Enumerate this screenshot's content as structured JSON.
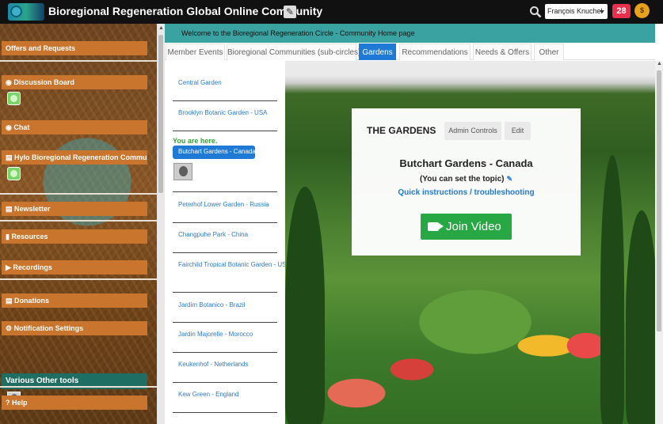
{
  "header": {
    "title": "Bioregional Regeneration Global Online Community",
    "edit_icon": "✎",
    "user_name": "François Knuchel",
    "notification_count": "28",
    "coin_label": "$"
  },
  "sidebar": {
    "items": [
      {
        "label": "Offers and Requests",
        "icon": ""
      },
      {
        "label": "Discussion Board",
        "icon": "comments-icon"
      },
      {
        "label": "Chat",
        "icon": "comment-icon"
      },
      {
        "label": "Hylo Bioregional Regeneration Community",
        "icon": "id-card-icon"
      },
      {
        "label": "Newsletter",
        "icon": "newspaper-icon"
      },
      {
        "label": "Resources",
        "icon": "book-icon"
      },
      {
        "label": "Recordings",
        "icon": "play-icon"
      },
      {
        "label": "Donations",
        "icon": "credit-card-icon"
      },
      {
        "label": "Notification Settings",
        "icon": "gear-icon"
      }
    ],
    "tools_label": "Various Other tools",
    "help_label": "? Help"
  },
  "welcome": "Welcome to the Bioregional Regeneration Circle - Community Home page",
  "tabs": [
    {
      "label": "Member Events"
    },
    {
      "label": "Bioregional Communities (sub-circles)"
    },
    {
      "label": "Gardens",
      "active": true
    },
    {
      "label": "Recommendations"
    },
    {
      "label": "Needs & Offers"
    },
    {
      "label": "Other"
    }
  ],
  "rooms": {
    "you_are_here": "You are here.",
    "current": "Butchart Gardens - Canada",
    "list": [
      "Central Garden",
      "Brooklyn Botanic Garden - USA",
      "Peterhof Lower Garden - Russia",
      "Changpuhe Park - China",
      "Fairchild Tropical Botanic Garden - USA",
      "Jardim Botanico - Brazil",
      "Jardin Majorelle - Morocco",
      "Keukenhof - Netherlands",
      "Kew Green - England"
    ]
  },
  "card": {
    "title": "THE GARDENS",
    "admin_label": "Admin Controls",
    "edit_label": "Edit",
    "room_name": "Butchart Gardens - Canada",
    "topic_hint": "(You can set the topic)",
    "instructions_link": "Quick instructions / troubleshooting",
    "join_label": "Join Video"
  },
  "colors": {
    "accent": "#1f7ad6",
    "sidebar_item": "#c9752e",
    "banner": "#3aa3a1",
    "join": "#28a745",
    "notification": "#e8304e"
  }
}
